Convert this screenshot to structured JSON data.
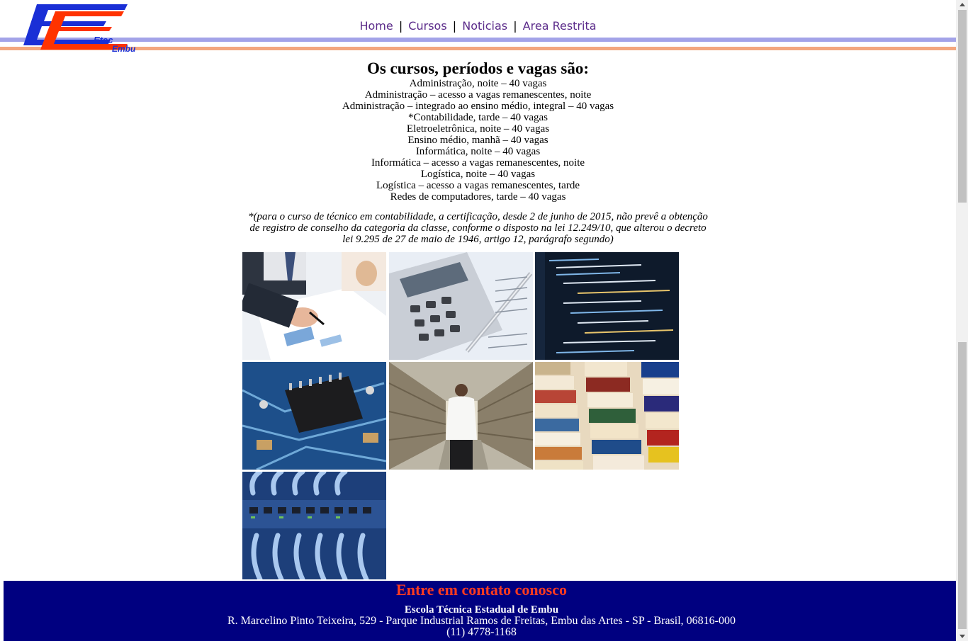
{
  "header": {
    "logo_text_1": "Etec",
    "logo_text_2": "Embu",
    "nav": [
      {
        "label": "Home"
      },
      {
        "label": "Cursos"
      },
      {
        "label": "Noticias"
      },
      {
        "label": "Area Restrita"
      }
    ],
    "separator": "|"
  },
  "main": {
    "title": "Os cursos, períodos e vagas são:",
    "courses": [
      "Administração, noite – 40 vagas",
      "Administração – acesso a vagas remanescentes, noite",
      "Administração – integrado ao ensino médio, integral – 40 vagas",
      "*Contabilidade, tarde – 40 vagas",
      "Eletroeletrônica, noite – 40 vagas",
      "Ensino médio, manhã – 40 vagas",
      "Informática, noite – 40 vagas",
      "Informática – acesso a vagas remanescentes, noite",
      "Logística, noite – 40 vagas",
      "Logística – acesso a vagas remanescentes, tarde",
      "Redes de computadores, tarde – 40 vagas"
    ],
    "note": "*(para o curso de técnico em contabilidade, a certificação, desde 2 de junho de 2015, não prevê a obtenção de registro de conselho da categoria da classe, conforme o disposto na lei 12.249/10, que alterou o decreto lei 9.295 de 27 de maio de 1946, artigo 12, parágrafo segundo)"
  },
  "footer": {
    "heading": "Entre em contato conosco",
    "school": "Escola Técnica Estadual de Embu",
    "address": "R. Marcelino Pinto Teixeira, 529 - Parque Industrial Ramos de Freitas, Embu das Artes - SP - Brasil, 06816-000",
    "phone": "(11) 4778-1168"
  },
  "colors": {
    "nav_link": "#5b2b8a",
    "footer_bg": "#000080",
    "footer_heading": "#ff3b1f",
    "logo_blue": "#1a2fd6",
    "logo_red": "#ff3300"
  }
}
